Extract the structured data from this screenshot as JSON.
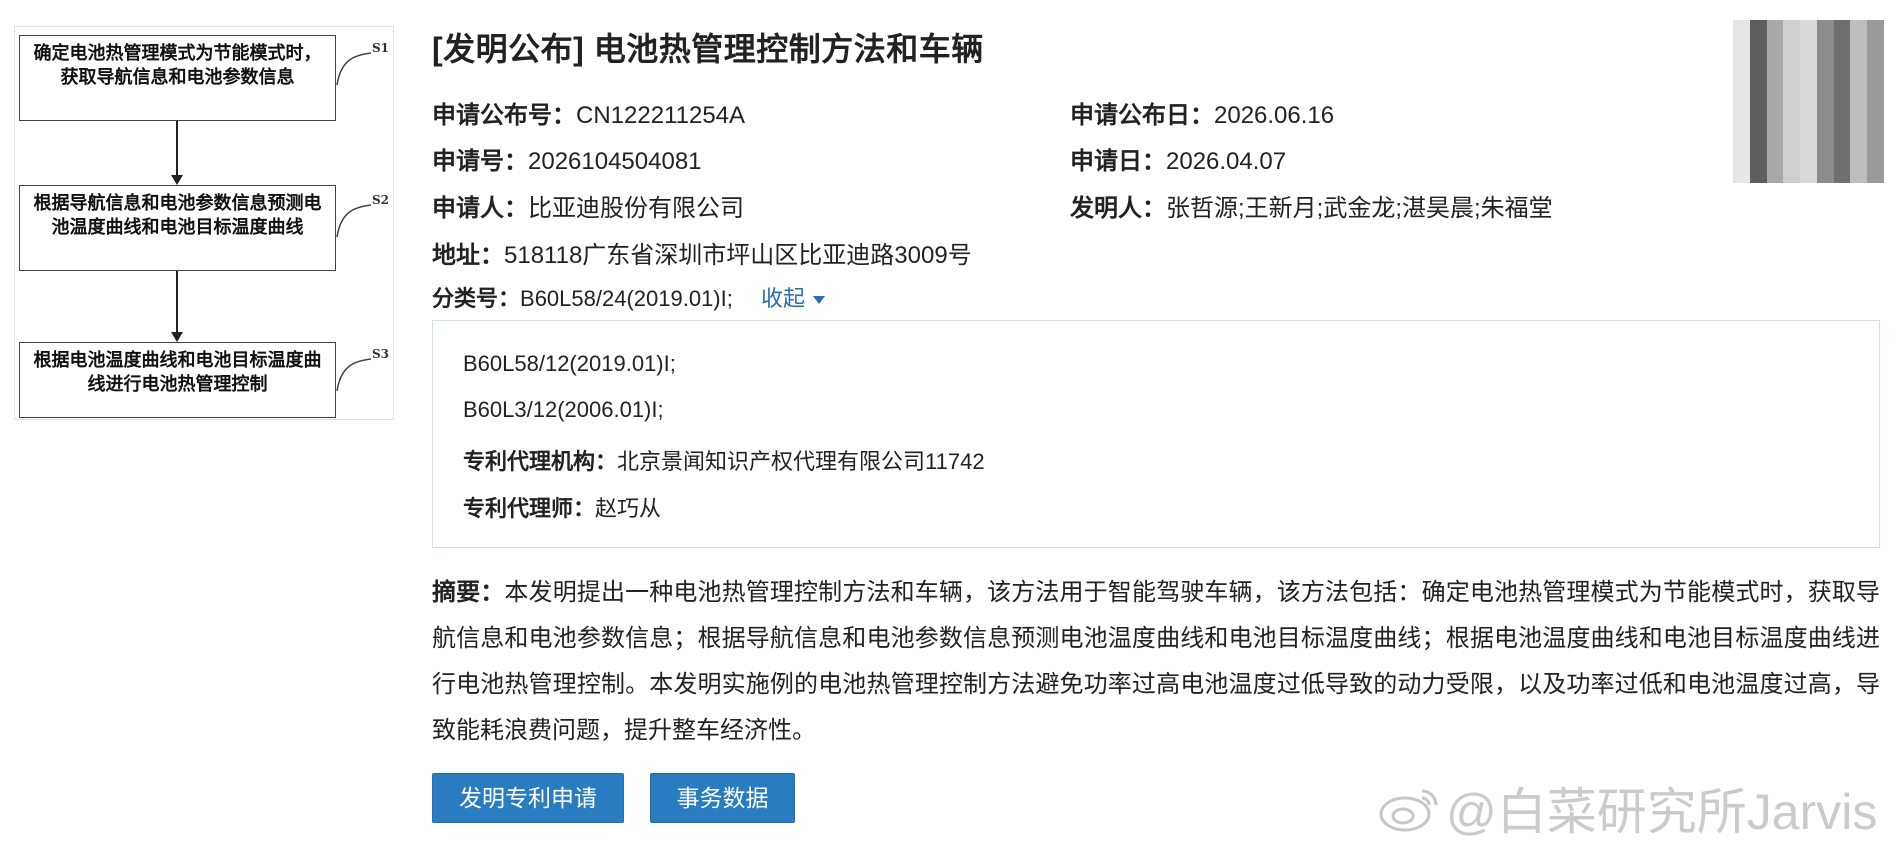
{
  "flowchart": {
    "steps": [
      {
        "text": "确定电池热管理模式为节能模式时，获取导航信息和电池参数信息",
        "label": "S1"
      },
      {
        "text": "根据导航信息和电池参数信息预测电池温度曲线和电池目标温度曲线",
        "label": "S2"
      },
      {
        "text": "根据电池温度曲线和电池目标温度曲线进行电池热管理控制",
        "label": "S3"
      }
    ]
  },
  "title": "[发明公布] 电池热管理控制方法和车辆",
  "fields": {
    "pub_no": {
      "key": "申请公布号：",
      "value": "CN122211254A"
    },
    "pub_date": {
      "key": "申请公布日：",
      "value": "2026.06.16"
    },
    "app_no": {
      "key": "申请号：",
      "value": "2026104504081"
    },
    "app_date": {
      "key": "申请日：",
      "value": "2026.04.07"
    },
    "applicant": {
      "key": "申请人：",
      "value": "比亚迪股份有限公司"
    },
    "inventors": {
      "key": "发明人：",
      "value": "张哲源;王新月;武金龙;湛昊晨;朱福堂"
    },
    "address": {
      "key": "地址：",
      "value": "518118广东省深圳市坪山区比亚迪路3009号"
    },
    "class_no": {
      "key": "分类号：",
      "value": "B60L58/24(2019.01)I;"
    }
  },
  "collapse_label": "收起",
  "panel": {
    "class_1": "B60L58/12(2019.01)I;",
    "class_2": "B60L3/12(2006.01)I;",
    "agency": {
      "key": "专利代理机构：",
      "value": "北京景闻知识产权代理有限公司11742"
    },
    "agent": {
      "key": "专利代理师：",
      "value": "赵巧从"
    }
  },
  "abstract": {
    "key": "摘要：",
    "text": "本发明提出一种电池热管理控制方法和车辆，该方法用于智能驾驶车辆，该方法包括：确定电池热管理模式为节能模式时，获取导航信息和电池参数信息；根据导航信息和电池参数信息预测电池温度曲线和电池目标温度曲线；根据电池温度曲线和电池目标温度曲线进行电池热管理控制。本发明实施例的电池热管理控制方法避免功率过高电池温度过低导致的动力受限，以及功率过低和电池温度过高，导致能耗浪费问题，提升整车经济性。"
  },
  "buttons": {
    "patent_app": "发明专利申请",
    "affairs": "事务数据"
  },
  "watermark": "@白菜研究所Jarvis",
  "colors": {
    "link": "#2b6db0",
    "button": "#2a7cc0",
    "panel_border": "#cfe3ec"
  }
}
